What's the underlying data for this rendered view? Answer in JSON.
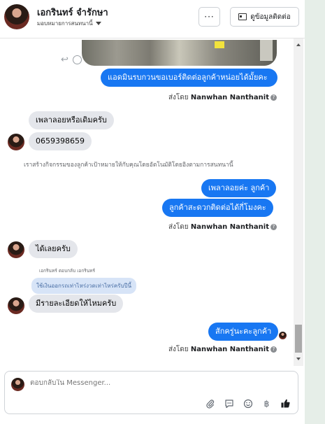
{
  "header": {
    "name": "เอกรินทร์ จำรักษา",
    "subtitle": "มอบหมายการสนทนานี้",
    "more_label": "···",
    "contact_label": "ดูข้อมูลติดต่อ"
  },
  "messages": [
    {
      "id": "m1",
      "side": "out",
      "text": "แอดมินรบกวนขอเบอร์ติดต่อลูกค้าหน่อยได้มั้ยคะ"
    },
    {
      "id": "m2",
      "side": "in",
      "text": "เพลาลอยหรือเดิมครับ"
    },
    {
      "id": "m3",
      "side": "in",
      "text": "0659398659"
    },
    {
      "id": "m4",
      "side": "out",
      "text": "เพลาลอยค่ะ ลูกค้า"
    },
    {
      "id": "m5",
      "side": "out",
      "text": "ลูกค้าสะดวกติดต่อได้กี่โมงคะ"
    },
    {
      "id": "m6",
      "side": "in",
      "text": "ได้เลยครับ"
    },
    {
      "id": "m7",
      "side": "in",
      "text": "มีรายละเอียดให้ไหมครับ"
    },
    {
      "id": "m8",
      "side": "out",
      "text": "สักครู่นะคะลูกค้า"
    }
  ],
  "sent_by": {
    "prefix": "ส่งโดย",
    "name": "Nanwhan Nanthanit",
    "help": "?"
  },
  "system_note": "เราสร้างกิจกรรมของลูกค้าเป้าหมายให้กับคุณโดยอัตโนมัติโดยอิงตามการสนทนานี้",
  "reply_label": "เอกรินทร์ ตอบกลับ เอกรินทร์",
  "quoted_text": "ใช้เงินออกรถเท่าไหร่งวดเท่าไหร่ครับปีนี้",
  "composer": {
    "placeholder": "ตอบกลับใน Messenger..."
  },
  "composer_icons": [
    "paperclip-icon",
    "chat-bubble-icon",
    "emoji-icon",
    "baht-icon",
    "thumbs-up-icon"
  ],
  "colors": {
    "outgoing": "#1877f2",
    "incoming": "#e4e6eb",
    "quote": "#d7e4f7"
  }
}
